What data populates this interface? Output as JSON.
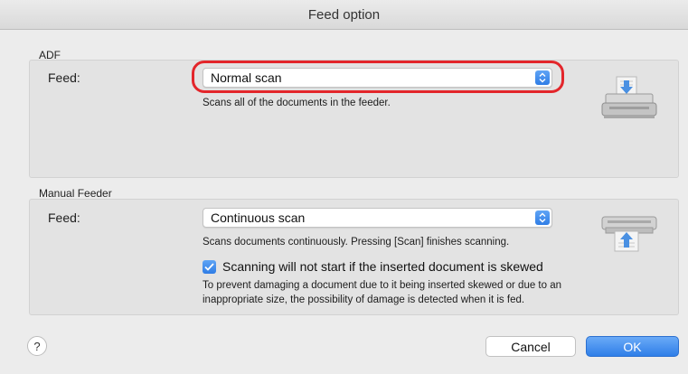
{
  "window": {
    "title": "Feed option"
  },
  "adf": {
    "section_label": "ADF",
    "feed_label": "Feed:",
    "feed_value": "Normal scan",
    "description": "Scans all of the documents in the feeder."
  },
  "manual_feeder": {
    "section_label": "Manual Feeder",
    "feed_label": "Feed:",
    "feed_value": "Continuous scan",
    "description": "Scans documents continuously. Pressing [Scan] finishes scanning.",
    "skew_checkbox": {
      "label": "Scanning will not start if the inserted document is skewed",
      "checked": true
    },
    "skew_note_line1": "To prevent damaging a document due to it being inserted skewed or due to an",
    "skew_note_line2": "inappropriate size, the possibility of damage is detected when it is fed."
  },
  "footer": {
    "help_label": "?",
    "cancel_label": "Cancel",
    "ok_label": "OK"
  },
  "colors": {
    "accent": "#2f7de6",
    "highlight": "#e3262b"
  },
  "icons": {
    "adf": "adf-scanner-icon",
    "manual": "manual-feeder-scanner-icon"
  }
}
